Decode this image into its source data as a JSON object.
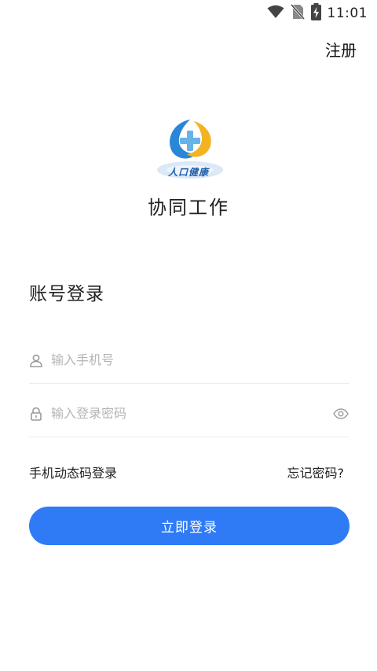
{
  "status_bar": {
    "time": "11:01",
    "icons": [
      "wifi-icon",
      "no-sim-icon",
      "battery-charging-icon"
    ]
  },
  "header": {
    "register_label": "注册"
  },
  "logo": {
    "icon": "app-logo",
    "text": "人口健康"
  },
  "app": {
    "title": "协同工作"
  },
  "login": {
    "heading": "账号登录",
    "phone_placeholder": "输入手机号",
    "phone_value": "",
    "password_placeholder": "输入登录密码",
    "password_value": "",
    "sms_login_label": "手机动态码登录",
    "forgot_label": "忘记密码?",
    "submit_label": "立即登录"
  },
  "colors": {
    "primary": "#2f7bf6",
    "placeholder": "#b5b5b5",
    "divider": "#ececec"
  }
}
